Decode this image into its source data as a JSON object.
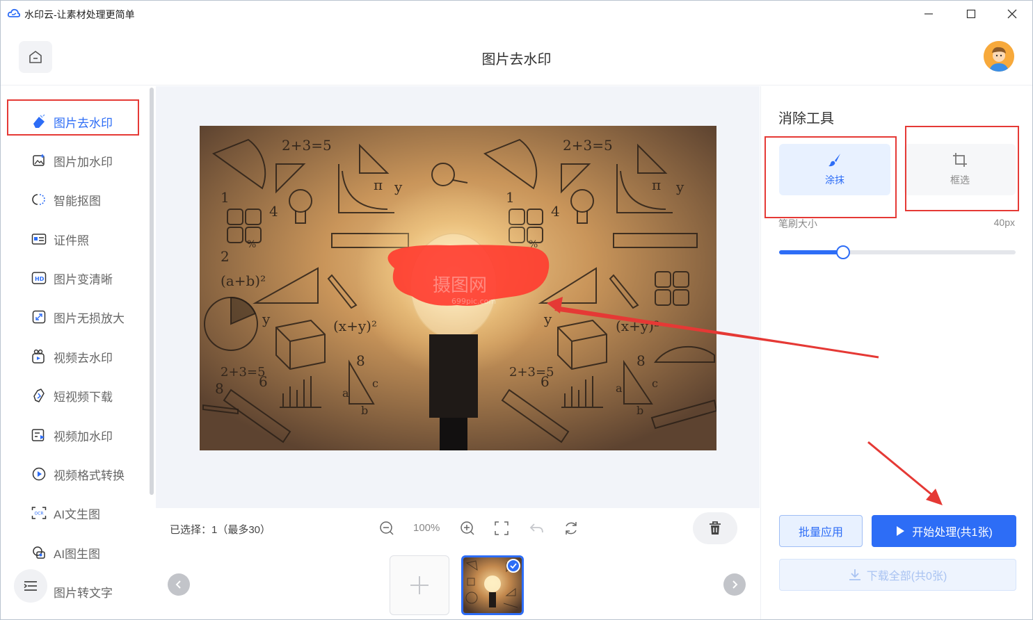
{
  "window": {
    "title": "水印云-让素材处理更简单",
    "controls": [
      "minimize-icon",
      "maximize-icon",
      "close-icon"
    ]
  },
  "header": {
    "title": "图片去水印",
    "home_icon": "home-icon",
    "avatar": "avatar"
  },
  "sidebar": {
    "items": [
      {
        "label": "图片去水印",
        "icon": "eraser-icon",
        "active": true
      },
      {
        "label": "图片加水印",
        "icon": "image-add-icon"
      },
      {
        "label": "智能抠图",
        "icon": "cutout-icon"
      },
      {
        "label": "证件照",
        "icon": "id-card-icon"
      },
      {
        "label": "图片变清晰",
        "icon": "hd-icon"
      },
      {
        "label": "图片无损放大",
        "icon": "enlarge-icon"
      },
      {
        "label": "视频去水印",
        "icon": "video-eraser-icon"
      },
      {
        "label": "短视频下载",
        "icon": "link-icon"
      },
      {
        "label": "视频加水印",
        "icon": "video-add-icon"
      },
      {
        "label": "视频格式转换",
        "icon": "play-circle-icon"
      },
      {
        "label": "AI文生图",
        "icon": "ocr-icon"
      },
      {
        "label": "AI图生图",
        "icon": "ai-image-icon"
      },
      {
        "label": "图片转文字",
        "icon": "text-icon"
      }
    ]
  },
  "canvas": {
    "watermark_text": "摄图网",
    "watermark_sub": "699pic.com",
    "photo_labels": [
      "2+3=5",
      "(a+b)²",
      "(x+y)²",
      "2+3=5",
      "π",
      "y",
      "1",
      "2",
      "4",
      "6",
      "8",
      "%",
      "a",
      "b",
      "c"
    ]
  },
  "bottom": {
    "selected": "已选择：1（最多30）",
    "zoom": "100%",
    "tools": [
      "zoom-out-icon",
      "zoom-in-icon",
      "fit-screen-icon",
      "undo-icon",
      "reset-icon"
    ],
    "thumb_count": 1
  },
  "panel": {
    "title": "消除工具",
    "modes": [
      {
        "label": "涂抹",
        "icon": "brush-icon",
        "active": true
      },
      {
        "label": "框选",
        "icon": "crop-icon",
        "active": false
      }
    ],
    "brush_label": "笔刷大小",
    "brush_value": "40px",
    "brush_level": 0.27,
    "batch_label": "批量应用",
    "start_label": "开始处理(共1张)",
    "download_label": "下载全部(共0张)"
  },
  "colors": {
    "accent": "#2d6df6",
    "annotation": "#e53935",
    "mask": "#ff3b2f"
  }
}
